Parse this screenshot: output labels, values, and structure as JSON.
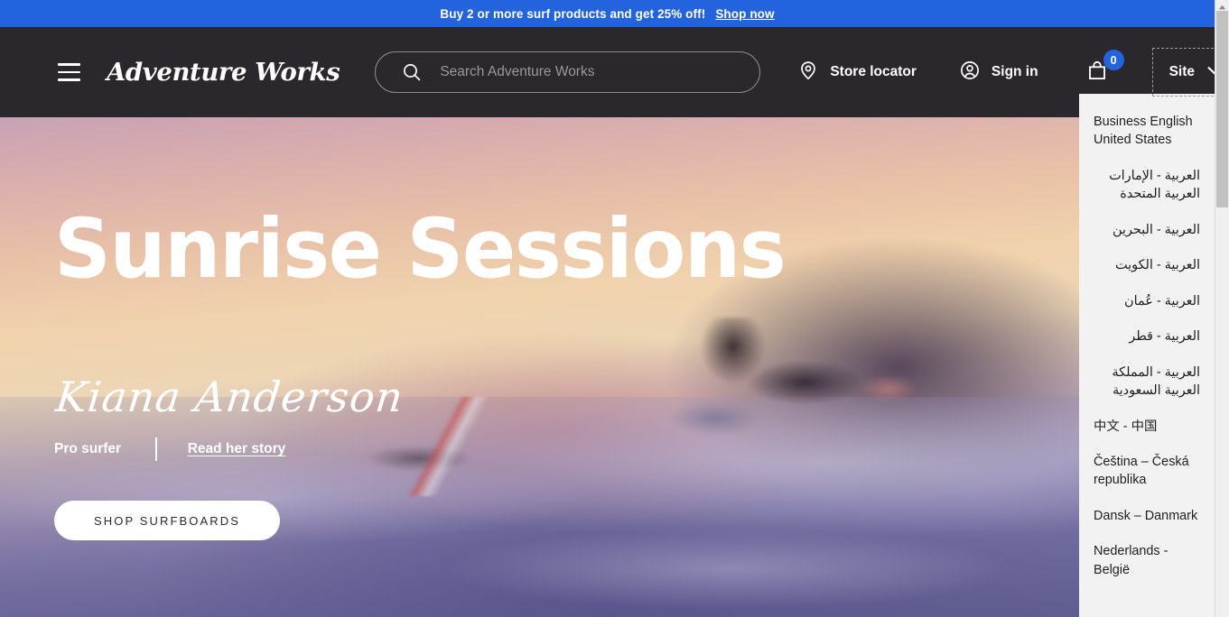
{
  "banner": {
    "message": "Buy 2 or more surf products and get 25% off!",
    "link_label": "Shop now",
    "background_color": "#2364DE"
  },
  "header": {
    "background_color": "#2B282D",
    "menu_icon": "hamburger-menu-icon",
    "brand": "Adventure Works",
    "search": {
      "icon": "search-icon",
      "placeholder": "Search Adventure Works",
      "value": ""
    },
    "store_locator": {
      "icon": "location-pin-icon",
      "label": "Store locator"
    },
    "sign_in": {
      "icon": "user-account-icon",
      "label": "Sign in"
    },
    "cart": {
      "icon": "shopping-bag-icon",
      "count": "0",
      "badge_color": "#2364DE"
    },
    "site_selector": {
      "label": "Site",
      "icon": "chevron-down-icon",
      "expanded": true
    }
  },
  "hero": {
    "title": "Sunrise Sessions",
    "person_name": "Kiana Anderson",
    "role": "Pro surfer",
    "story_link": "Read her story",
    "cta_label": "SHOP SURFBOARDS",
    "image_description": "Pro surfer paddling on a wave at sunrise"
  },
  "site_dropdown": {
    "options": [
      {
        "label": "Business English United States",
        "rtl": false
      },
      {
        "label": "العربية - الإمارات العربية المتحدة",
        "rtl": true
      },
      {
        "label": "العربية - البحرين",
        "rtl": true
      },
      {
        "label": "العربية - الكويت",
        "rtl": true
      },
      {
        "label": "العربية - عُمان",
        "rtl": true
      },
      {
        "label": "العربية - قطر",
        "rtl": true
      },
      {
        "label": "العربية - المملكة العربية السعودية",
        "rtl": true
      },
      {
        "label": "中文 - 中国",
        "rtl": false
      },
      {
        "label": "Čeština – Česká republika",
        "rtl": false
      },
      {
        "label": "Dansk – Danmark",
        "rtl": false
      },
      {
        "label": "Nederlands - België",
        "rtl": false
      }
    ]
  },
  "scrollbar": {
    "up_arrow_icon": "scroll-up-arrow-icon"
  }
}
